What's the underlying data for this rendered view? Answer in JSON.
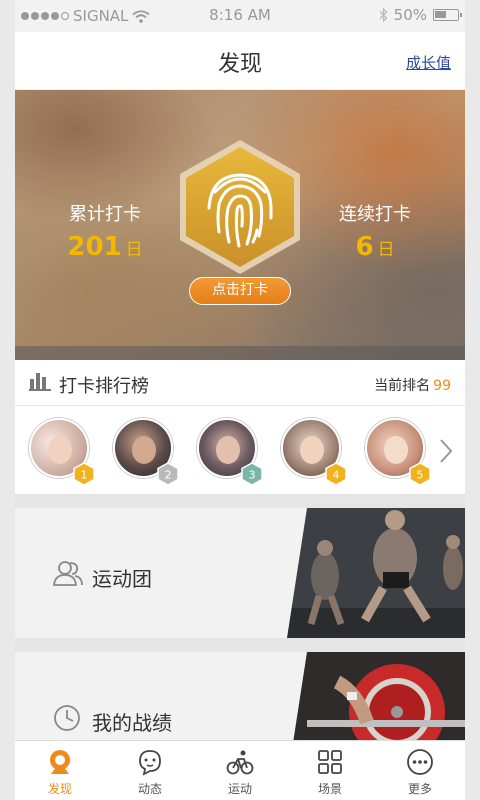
{
  "status_bar": {
    "carrier": "SIGNAL",
    "time": "8:16 AM",
    "battery": "50%"
  },
  "nav": {
    "title": "发现",
    "right_link": "成长值"
  },
  "hero": {
    "left_label": "累计打卡",
    "left_value": "201",
    "left_unit": "日",
    "right_label": "连续打卡",
    "right_value": "6",
    "right_unit": "日",
    "checkin_button": "点击打卡",
    "accent_color": "#f5b800"
  },
  "ranking": {
    "title": "打卡排行榜",
    "current_rank_label": "当前排名",
    "current_rank_value": "99",
    "users": [
      {
        "rank": "1"
      },
      {
        "rank": "2"
      },
      {
        "rank": "3"
      },
      {
        "rank": "4"
      },
      {
        "rank": "5"
      }
    ]
  },
  "cards": [
    {
      "label": "运动团",
      "icon": "group-icon"
    },
    {
      "label": "我的战绩",
      "icon": "clock-icon"
    }
  ],
  "tabs": [
    {
      "label": "发现",
      "icon": "discover-icon",
      "active": true
    },
    {
      "label": "动态",
      "icon": "chat-bubble-icon"
    },
    {
      "label": "运动",
      "icon": "cycling-icon"
    },
    {
      "label": "场景",
      "icon": "grid-icon"
    },
    {
      "label": "更多",
      "icon": "more-icon"
    }
  ]
}
